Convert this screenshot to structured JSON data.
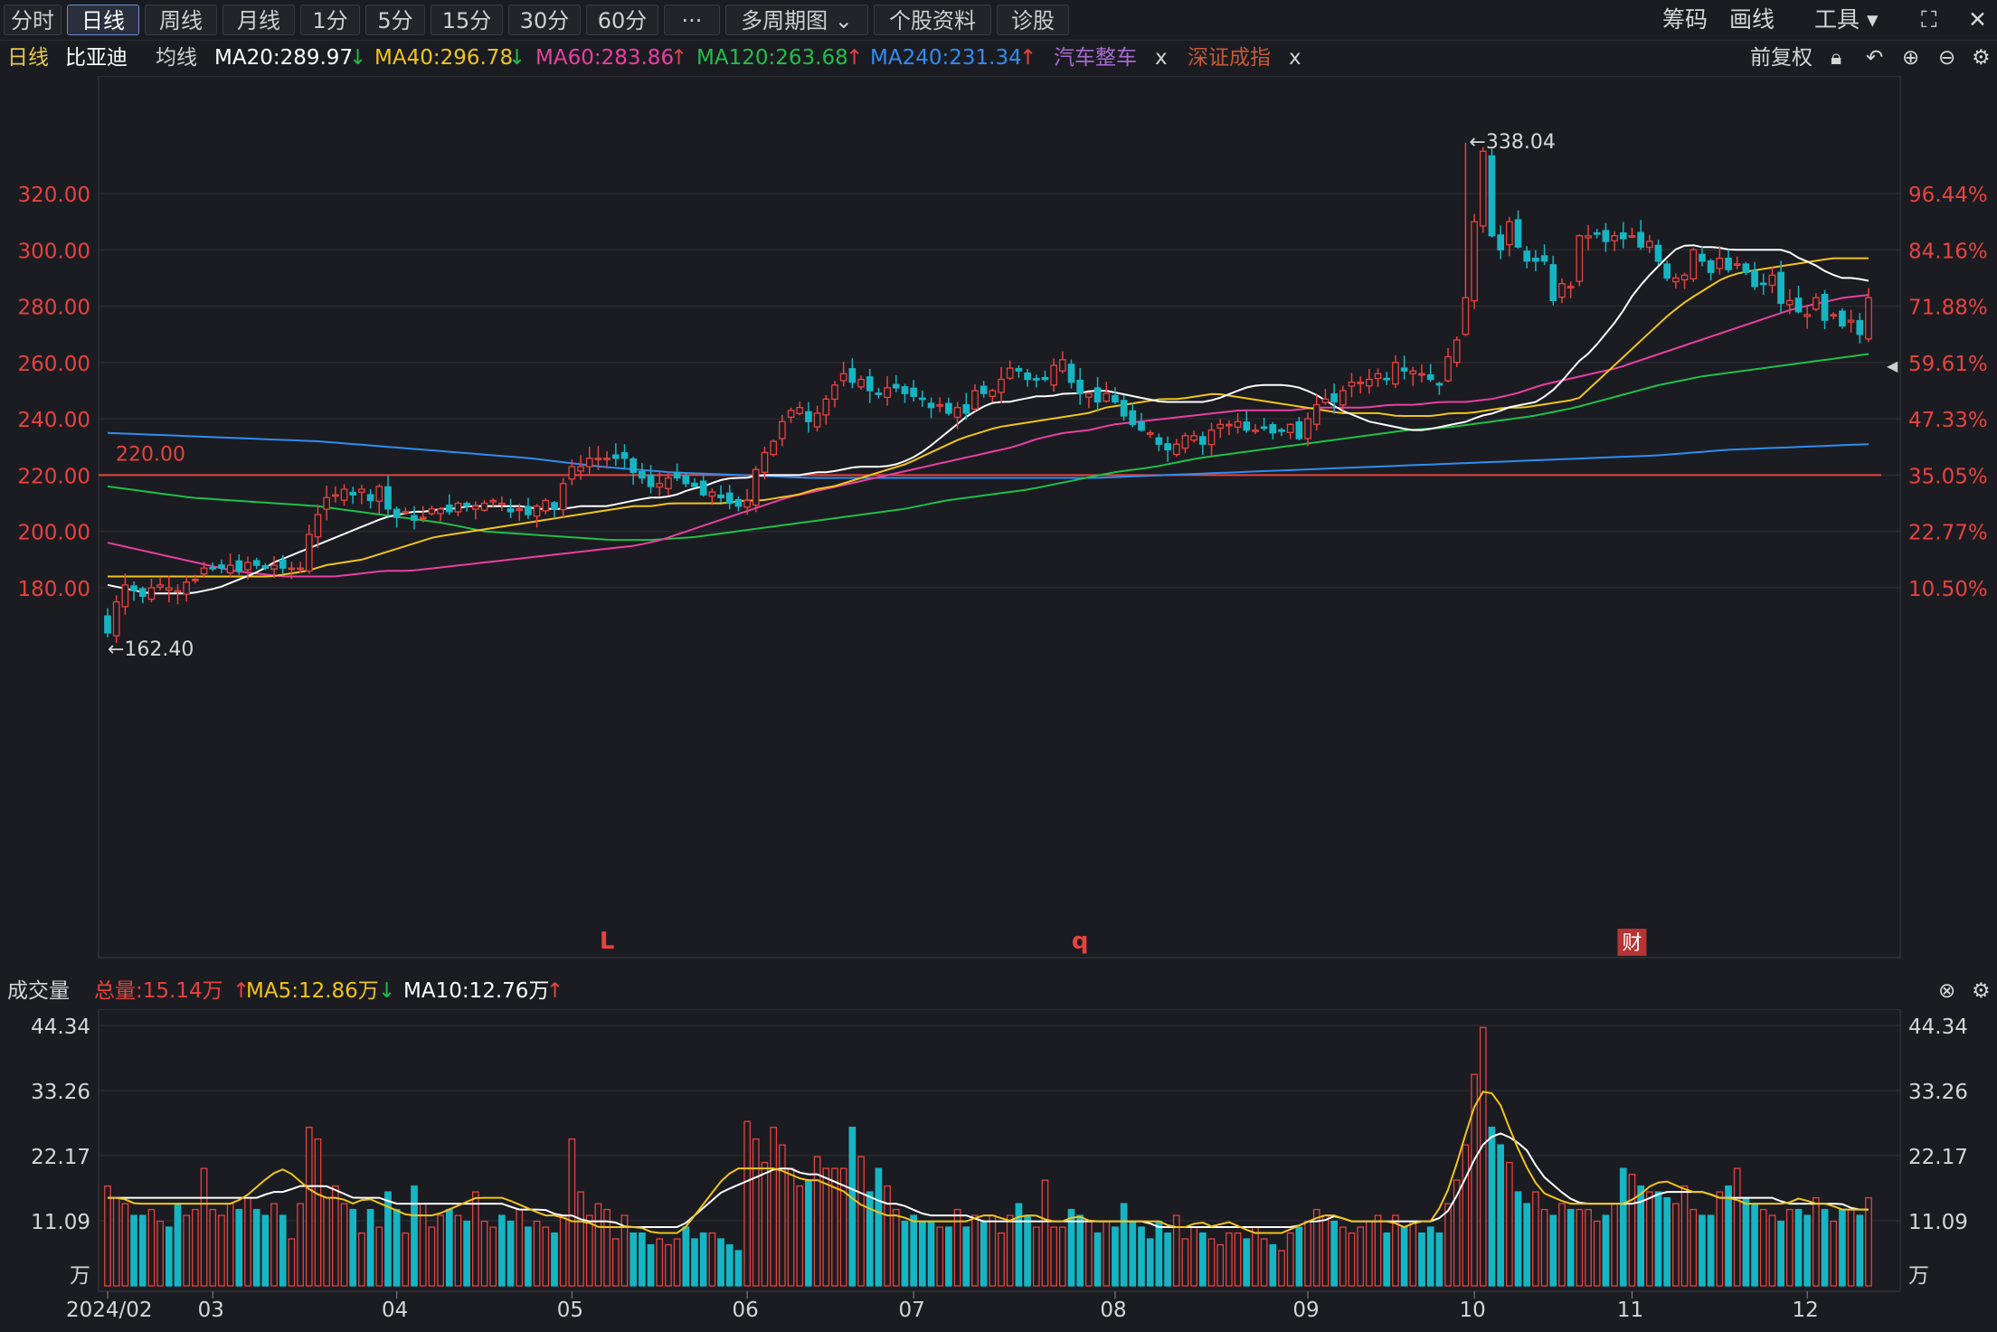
{
  "toolbar": {
    "tabs": [
      "分时",
      "日线",
      "周线",
      "月线",
      "1分",
      "5分",
      "15分",
      "30分",
      "60分",
      "···",
      "多周期图",
      "个股资料",
      "诊股"
    ],
    "active": "日线",
    "right": [
      "筹码",
      "画线",
      "工具"
    ]
  },
  "info": {
    "period": "日线",
    "stock": "比亚迪",
    "ma_label": "均线",
    "ma20": "MA20:289.97",
    "ma40": "MA40:296.78",
    "ma60": "MA60:283.86",
    "ma120": "MA120:263.68",
    "ma240": "MA240:231.34",
    "sector1": "汽车整车",
    "sector2": "深证成指",
    "close_x": "x",
    "adjust": "前复权"
  },
  "colors": {
    "up": "#e8423f",
    "down": "#16b5c3",
    "ma20": "#ffffff",
    "ma40": "#f0c419",
    "ma60": "#ea3fa3",
    "ma120": "#1fbf4a",
    "ma240": "#2f8df2"
  },
  "volume_info": {
    "label": "成交量",
    "total": "总量:15.14万",
    "ma5": "MA5:12.86万",
    "ma10": "MA10:12.76万"
  },
  "chart_data": [
    {
      "type": "candlestick",
      "ylim": [
        152,
        345
      ],
      "yticks": [
        "180.00",
        "200.00",
        "220.00",
        "240.00",
        "260.00",
        "280.00",
        "300.00",
        "320.00"
      ],
      "ytick_values": [
        180,
        200,
        220,
        240,
        260,
        280,
        300,
        320
      ],
      "y2ticks": [
        "10.50%",
        "22.77%",
        "35.05%",
        "47.33%",
        "59.61%",
        "71.88%",
        "84.16%",
        "96.44%"
      ],
      "xticks": [
        "2024/02",
        "03",
        "04",
        "05",
        "06",
        "07",
        "08",
        "09",
        "10",
        "11",
        "12"
      ],
      "x_tick_dates": [
        0,
        12,
        33,
        53,
        73,
        92,
        115,
        137,
        156,
        174,
        194
      ],
      "annotations": {
        "high": "←338.04",
        "low": "←162.40",
        "line": "220.00",
        "line_value": 220,
        "marks": [
          "L",
          "q",
          "财"
        ],
        "mark_dates": [
          57,
          111,
          174
        ]
      },
      "close": [
        164,
        175,
        181,
        179,
        177,
        180,
        181,
        180,
        179,
        182,
        183,
        187,
        187,
        187,
        188,
        186,
        189,
        188,
        187,
        188,
        187,
        187,
        187,
        199,
        206,
        212,
        213,
        215,
        213,
        215,
        211,
        216,
        208,
        205,
        207,
        204,
        205,
        208,
        208,
        207,
        210,
        209,
        209,
        210,
        211,
        210,
        207,
        208,
        206,
        209,
        211,
        208,
        217,
        223,
        223,
        226,
        226,
        226,
        226,
        226,
        221,
        219,
        216,
        217,
        219,
        219,
        217,
        216,
        213,
        214,
        212,
        210,
        209,
        211,
        222,
        228,
        232,
        239,
        243,
        244,
        239,
        242,
        247,
        252,
        256,
        253,
        254,
        250,
        249,
        251,
        251,
        249,
        248,
        247,
        244,
        245,
        242,
        244,
        242,
        250,
        249,
        250,
        254,
        258,
        257,
        254,
        254,
        254,
        259,
        261,
        253,
        249,
        249,
        246,
        249,
        246,
        241,
        238,
        236,
        235,
        231,
        229,
        231,
        234,
        234,
        231,
        236,
        238,
        238,
        239,
        236,
        236,
        237,
        235,
        236,
        238,
        233,
        240,
        245,
        247,
        246,
        250,
        253,
        253,
        254,
        256,
        254,
        260,
        257,
        257,
        256,
        254,
        252,
        262,
        268,
        283,
        310,
        335,
        305,
        300,
        310,
        301,
        296,
        296,
        296,
        282,
        288,
        287,
        305,
        305,
        306,
        303,
        305,
        304,
        305,
        301,
        303,
        296,
        290,
        290,
        291,
        300,
        296,
        292,
        297,
        293,
        295,
        292,
        287,
        288,
        291,
        281,
        282,
        278,
        277,
        283,
        275,
        277,
        273,
        275,
        270,
        283
      ],
      "ma20": [
        181,
        180,
        179,
        178,
        178,
        178,
        178,
        179,
        180,
        182,
        184,
        186,
        189,
        191,
        193,
        195,
        197,
        199,
        201,
        203,
        205,
        206,
        207,
        207,
        208,
        208,
        209,
        209,
        209,
        209,
        209,
        208,
        208,
        208,
        209,
        209,
        209,
        210,
        211,
        212,
        212,
        213,
        215,
        216,
        218,
        219,
        219,
        220,
        220,
        220,
        220,
        221,
        221,
        222,
        223,
        223,
        223,
        224,
        226,
        229,
        233,
        237,
        241,
        244,
        246,
        246,
        247,
        248,
        248,
        249,
        249,
        250,
        250,
        249,
        248,
        247,
        246,
        246,
        246,
        246,
        247,
        249,
        251,
        252,
        252,
        252,
        251,
        249,
        246,
        243,
        241,
        239,
        238,
        237,
        236,
        236,
        237,
        238,
        239,
        241,
        242,
        244,
        245,
        246,
        249,
        254,
        260,
        264,
        270,
        276,
        284,
        290,
        295,
        300,
        302,
        301,
        301,
        300,
        300,
        300,
        300,
        300,
        297,
        295,
        292,
        290,
        290,
        289
      ],
      "ma40": [
        184,
        184,
        184,
        184,
        184,
        184,
        184,
        184,
        184,
        184,
        185,
        186,
        188,
        189,
        190,
        192,
        194,
        196,
        198,
        199,
        200,
        201,
        202,
        203,
        204,
        205,
        206,
        207,
        208,
        209,
        209,
        210,
        210,
        210,
        210,
        211,
        211,
        212,
        213,
        215,
        216,
        218,
        220,
        222,
        224,
        227,
        230,
        233,
        235,
        237,
        238,
        239,
        240,
        241,
        242,
        244,
        245,
        246,
        247,
        247,
        248,
        249,
        248,
        247,
        246,
        245,
        244,
        243,
        242,
        242,
        242,
        241,
        241,
        241,
        242,
        242,
        243,
        244,
        244,
        245,
        246,
        247,
        253,
        259,
        265,
        271,
        277,
        282,
        286,
        290,
        292,
        293,
        294,
        295,
        296,
        297,
        297,
        297
      ],
      "ma60": [
        196,
        194,
        192,
        190,
        188,
        186,
        185,
        184,
        184,
        184,
        185,
        186,
        186,
        187,
        188,
        189,
        190,
        191,
        192,
        193,
        194,
        195,
        197,
        200,
        203,
        206,
        209,
        212,
        214,
        216,
        218,
        220,
        222,
        224,
        226,
        228,
        230,
        233,
        235,
        236,
        238,
        239,
        240,
        241,
        242,
        243,
        243,
        243,
        244,
        244,
        244,
        245,
        245,
        246,
        246,
        247,
        249,
        252,
        254,
        256,
        258,
        261,
        264,
        267,
        270,
        273,
        276,
        279,
        281,
        283,
        284
      ],
      "ma120": [
        216,
        214,
        212,
        211,
        210,
        209,
        207,
        205,
        203,
        200,
        199,
        198,
        197,
        197,
        198,
        200,
        202,
        204,
        206,
        208,
        211,
        213,
        215,
        218,
        221,
        223,
        226,
        228,
        230,
        232,
        234,
        236,
        237,
        239,
        241,
        244,
        248,
        252,
        255,
        257,
        259,
        261,
        263
      ],
      "ma240": [
        235,
        234,
        233,
        232,
        230,
        228,
        226,
        223,
        221,
        220,
        219,
        219,
        219,
        219,
        219,
        220,
        221,
        222,
        223,
        224,
        225,
        226,
        227,
        229,
        230,
        231
      ]
    },
    {
      "type": "bar",
      "title": "成交量",
      "ylim": [
        0,
        44.34
      ],
      "yticks": [
        "11.09",
        "22.17",
        "33.26",
        "44.34"
      ],
      "ytick_values": [
        11.09,
        22.17,
        33.26,
        44.34
      ],
      "y_unit": "万",
      "values": [
        17,
        15,
        14,
        12,
        12,
        13,
        11,
        10,
        14,
        12,
        13,
        20,
        13,
        12,
        14,
        13,
        15,
        13,
        12,
        14,
        12,
        8,
        14,
        27,
        25,
        15,
        17,
        14,
        13,
        9,
        13,
        10,
        16,
        13,
        9,
        17,
        14,
        10,
        12,
        13,
        12,
        11,
        16,
        11,
        10,
        12,
        11,
        13,
        10,
        11,
        10,
        9,
        12,
        25,
        16,
        12,
        14,
        13,
        8,
        12,
        9,
        9,
        7,
        8,
        7,
        8,
        10,
        8,
        9,
        9,
        8,
        7,
        6,
        28,
        25,
        21,
        27,
        24,
        20,
        17,
        18,
        22,
        20,
        20,
        20,
        27,
        22,
        16,
        20,
        17,
        13,
        11,
        12,
        11,
        11,
        10,
        10,
        13,
        10,
        12,
        11,
        12,
        9,
        12,
        14,
        12,
        10,
        18,
        10,
        10,
        13,
        12,
        11,
        9,
        11,
        10,
        14,
        11,
        10,
        8,
        11,
        9,
        12,
        8,
        10,
        9,
        8,
        7,
        9,
        9,
        8,
        10,
        8,
        7,
        6,
        9,
        10,
        11,
        13,
        12,
        11,
        10,
        9,
        10,
        11,
        12,
        9,
        12,
        10,
        11,
        9,
        10,
        9,
        14,
        18,
        24,
        36,
        44,
        27,
        24,
        21,
        16,
        14,
        16,
        13,
        12,
        14,
        13,
        13,
        13,
        11,
        12,
        14,
        20,
        19,
        17,
        16,
        16,
        15,
        14,
        17,
        13,
        12,
        12,
        16,
        17,
        20,
        15,
        14,
        13,
        12,
        11,
        13,
        13,
        12,
        15,
        13,
        11,
        13,
        13,
        12,
        15
      ],
      "ma5": [
        15,
        15,
        14,
        14,
        14,
        14,
        14,
        14,
        14,
        14,
        15,
        17,
        19,
        20,
        18,
        16,
        15,
        15,
        14,
        15,
        14,
        13,
        12,
        12,
        12,
        13,
        14,
        15,
        15,
        15,
        14,
        13,
        12,
        12,
        11,
        11,
        10,
        10,
        10,
        10,
        9,
        9,
        9,
        12,
        15,
        18,
        20,
        20,
        20,
        20,
        19,
        18,
        18,
        17,
        16,
        14,
        13,
        12,
        12,
        11,
        11,
        11,
        11,
        11,
        12,
        12,
        11,
        12,
        12,
        11,
        11,
        12,
        11,
        11,
        11,
        11,
        11,
        11,
        10,
        10,
        11,
        10,
        11,
        10,
        9,
        9,
        9,
        10,
        11,
        12,
        12,
        11,
        11,
        11,
        11,
        10,
        11,
        11,
        15,
        22,
        30,
        34,
        31,
        25,
        20,
        16,
        15,
        14,
        14,
        14,
        14,
        14,
        15,
        17,
        18,
        17,
        16,
        16,
        15,
        15,
        14,
        14,
        14,
        14,
        15,
        14,
        14,
        13,
        13,
        13
      ],
      "ma10": [
        15,
        15,
        15,
        15,
        15,
        15,
        15,
        15,
        15,
        15,
        15,
        15,
        16,
        16,
        17,
        17,
        17,
        16,
        15,
        15,
        15,
        14,
        14,
        14,
        14,
        14,
        14,
        14,
        14,
        14,
        13,
        13,
        13,
        12,
        12,
        11,
        11,
        11,
        10,
        10,
        10,
        10,
        10,
        12,
        14,
        16,
        17,
        18,
        19,
        20,
        20,
        19,
        19,
        18,
        17,
        16,
        15,
        14,
        14,
        13,
        12,
        12,
        12,
        12,
        11,
        11,
        11,
        11,
        11,
        11,
        11,
        11,
        11,
        11,
        11,
        11,
        11,
        10,
        10,
        10,
        10,
        10,
        10,
        10,
        10,
        10,
        10,
        10,
        11,
        11,
        12,
        11,
        11,
        11,
        11,
        11,
        11,
        11,
        12,
        16,
        21,
        25,
        26,
        25,
        23,
        19,
        17,
        15,
        14,
        14,
        14,
        14,
        14,
        15,
        16,
        16,
        16,
        16,
        15,
        15,
        15,
        15,
        15,
        14,
        14,
        14,
        14,
        14,
        13,
        13
      ]
    }
  ]
}
